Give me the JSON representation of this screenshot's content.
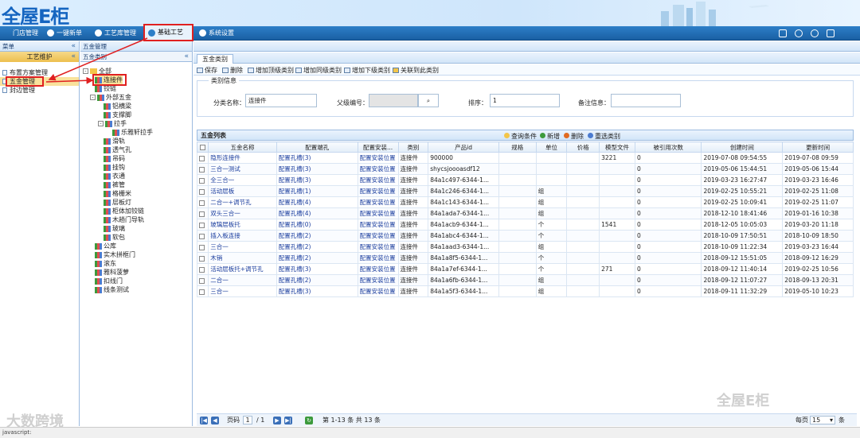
{
  "app": {
    "logo": "全屋E柜",
    "status": "javascript:"
  },
  "nav": {
    "items": [
      "门店管理",
      "一键新单",
      "工艺库管理",
      "基础工艺",
      "系统设置"
    ]
  },
  "left": {
    "header": "菜单",
    "subheader": "工艺维护",
    "items": [
      "布置方案管理",
      "五金管理",
      "封边管理"
    ]
  },
  "tree": {
    "header": "五金管理",
    "subheader": "五金类别",
    "nodes": [
      "全部",
      "连接件",
      "铰链",
      "外部五金",
      "铝横梁",
      "支撑脚",
      "拉手",
      "乐雅轩拉手",
      "滑轨",
      "透气孔",
      "吊码",
      "挂钩",
      "衣通",
      "裤管",
      "格栅米",
      "层板灯",
      "柜体加铰链",
      "木趟门导轨",
      "玻璃",
      "软包",
      "公库",
      "实木拼框门",
      "滚东",
      "雅科菠萝",
      "扣线门",
      "线条测试"
    ]
  },
  "main": {
    "tab": "五金类别",
    "toolbar": [
      "保存",
      "删除",
      "增加顶级类别",
      "增加同级类别",
      "增加下级类别",
      "关联到此类别"
    ],
    "legend": "类别信息",
    "form": {
      "name_label": "分类名称：",
      "name_value": "连接件",
      "parent_label": "父级编号：",
      "parent_value": "",
      "order_label": "排序：",
      "order_value": "1",
      "remark_label": "备注信息：",
      "remark_value": ""
    },
    "grid_title": "五金列表",
    "grid_buttons": [
      "查询条件",
      "新增",
      "删除",
      "重选类别"
    ],
    "columns": [
      "",
      "五金名称",
      "配置端孔",
      "配置安装...",
      "类别",
      "产品id",
      "规格",
      "单位",
      "价格",
      "模型文件",
      "被引用次数",
      "创建时间",
      "更新时间"
    ],
    "rows": [
      [
        "隐形连接件",
        "配置孔槽(3)",
        "配置安装位置",
        "连接件",
        "900000",
        "",
        "",
        "",
        "3221",
        "0",
        "2019-07-08 09:54:55",
        "2019-07-08 09:59"
      ],
      [
        "三合一测试",
        "配置孔槽(3)",
        "配置安装位置",
        "连接件",
        "shycsjoooasdf12",
        "",
        "",
        "",
        "",
        "0",
        "2019-05-06 15:44:51",
        "2019-05-06 15:44"
      ],
      [
        "全三合一",
        "配置孔槽(3)",
        "配置安装位置",
        "连接件",
        "84a1c497-6344-1...",
        "",
        "",
        "",
        "",
        "0",
        "2019-03-23 16:27:47",
        "2019-03-23 16:46"
      ],
      [
        "活动层板",
        "配置孔槽(1)",
        "配置安装位置",
        "连接件",
        "84a1c246-6344-1...",
        "",
        "组",
        "",
        "",
        "0",
        "2019-02-25 10:55:21",
        "2019-02-25 11:08"
      ],
      [
        "二合一+调节孔",
        "配置孔槽(4)",
        "配置安装位置",
        "连接件",
        "84a1c143-6344-1...",
        "",
        "组",
        "",
        "",
        "0",
        "2019-02-25 10:09:41",
        "2019-02-25 11:07"
      ],
      [
        "双头三合一",
        "配置孔槽(4)",
        "配置安装位置",
        "连接件",
        "84a1ada7-6344-1...",
        "",
        "组",
        "",
        "",
        "0",
        "2018-12-10 18:41:46",
        "2019-01-16 10:38"
      ],
      [
        "玻璃层板托",
        "配置孔槽(0)",
        "配置安装位置",
        "连接件",
        "84a1acb9-6344-1...",
        "",
        "个",
        "",
        "1541",
        "0",
        "2018-12-05 10:05:03",
        "2019-03-20 11:18"
      ],
      [
        "插入板连接",
        "配置孔槽(2)",
        "配置安装位置",
        "连接件",
        "84a1abc4-6344-1...",
        "",
        "个",
        "",
        "",
        "0",
        "2018-10-09 17:50:51",
        "2018-10-09 18:50"
      ],
      [
        "三合一",
        "配置孔槽(2)",
        "配置安装位置",
        "连接件",
        "84a1aad3-6344-1...",
        "",
        "组",
        "",
        "",
        "0",
        "2018-10-09 11:22:34",
        "2019-03-23 16:44"
      ],
      [
        "木销",
        "配置孔槽(2)",
        "配置安装位置",
        "连接件",
        "84a1a8f5-6344-1...",
        "",
        "个",
        "",
        "",
        "0",
        "2018-09-12 15:51:05",
        "2018-09-12 16:29"
      ],
      [
        "活动层板托+调节孔",
        "配置孔槽(3)",
        "配置安装位置",
        "连接件",
        "84a1a7ef-6344-1...",
        "",
        "个",
        "",
        "271",
        "0",
        "2018-09-12 11:40:14",
        "2019-02-25 10:56"
      ],
      [
        "二合一",
        "配置孔槽(2)",
        "配置安装位置",
        "连接件",
        "84a1a6fb-6344-1...",
        "",
        "组",
        "",
        "",
        "0",
        "2018-09-12 11:07:27",
        "2018-09-13 20:31"
      ],
      [
        "三合一",
        "配置孔槽(3)",
        "配置安装位置",
        "连接件",
        "84a1a5f3-6344-1...",
        "",
        "组",
        "",
        "",
        "0",
        "2018-09-11 11:32:29",
        "2019-05-10 10:23"
      ]
    ],
    "pager": {
      "page_label": "页码",
      "page": "1",
      "total_pages": "/ 1",
      "summary": "第 1-13 条  共 13 条",
      "per_page_label": "每页",
      "per_page": "15",
      "unit": "条"
    }
  },
  "watermarks": [
    "大数跨境",
    "全屋E柜"
  ]
}
